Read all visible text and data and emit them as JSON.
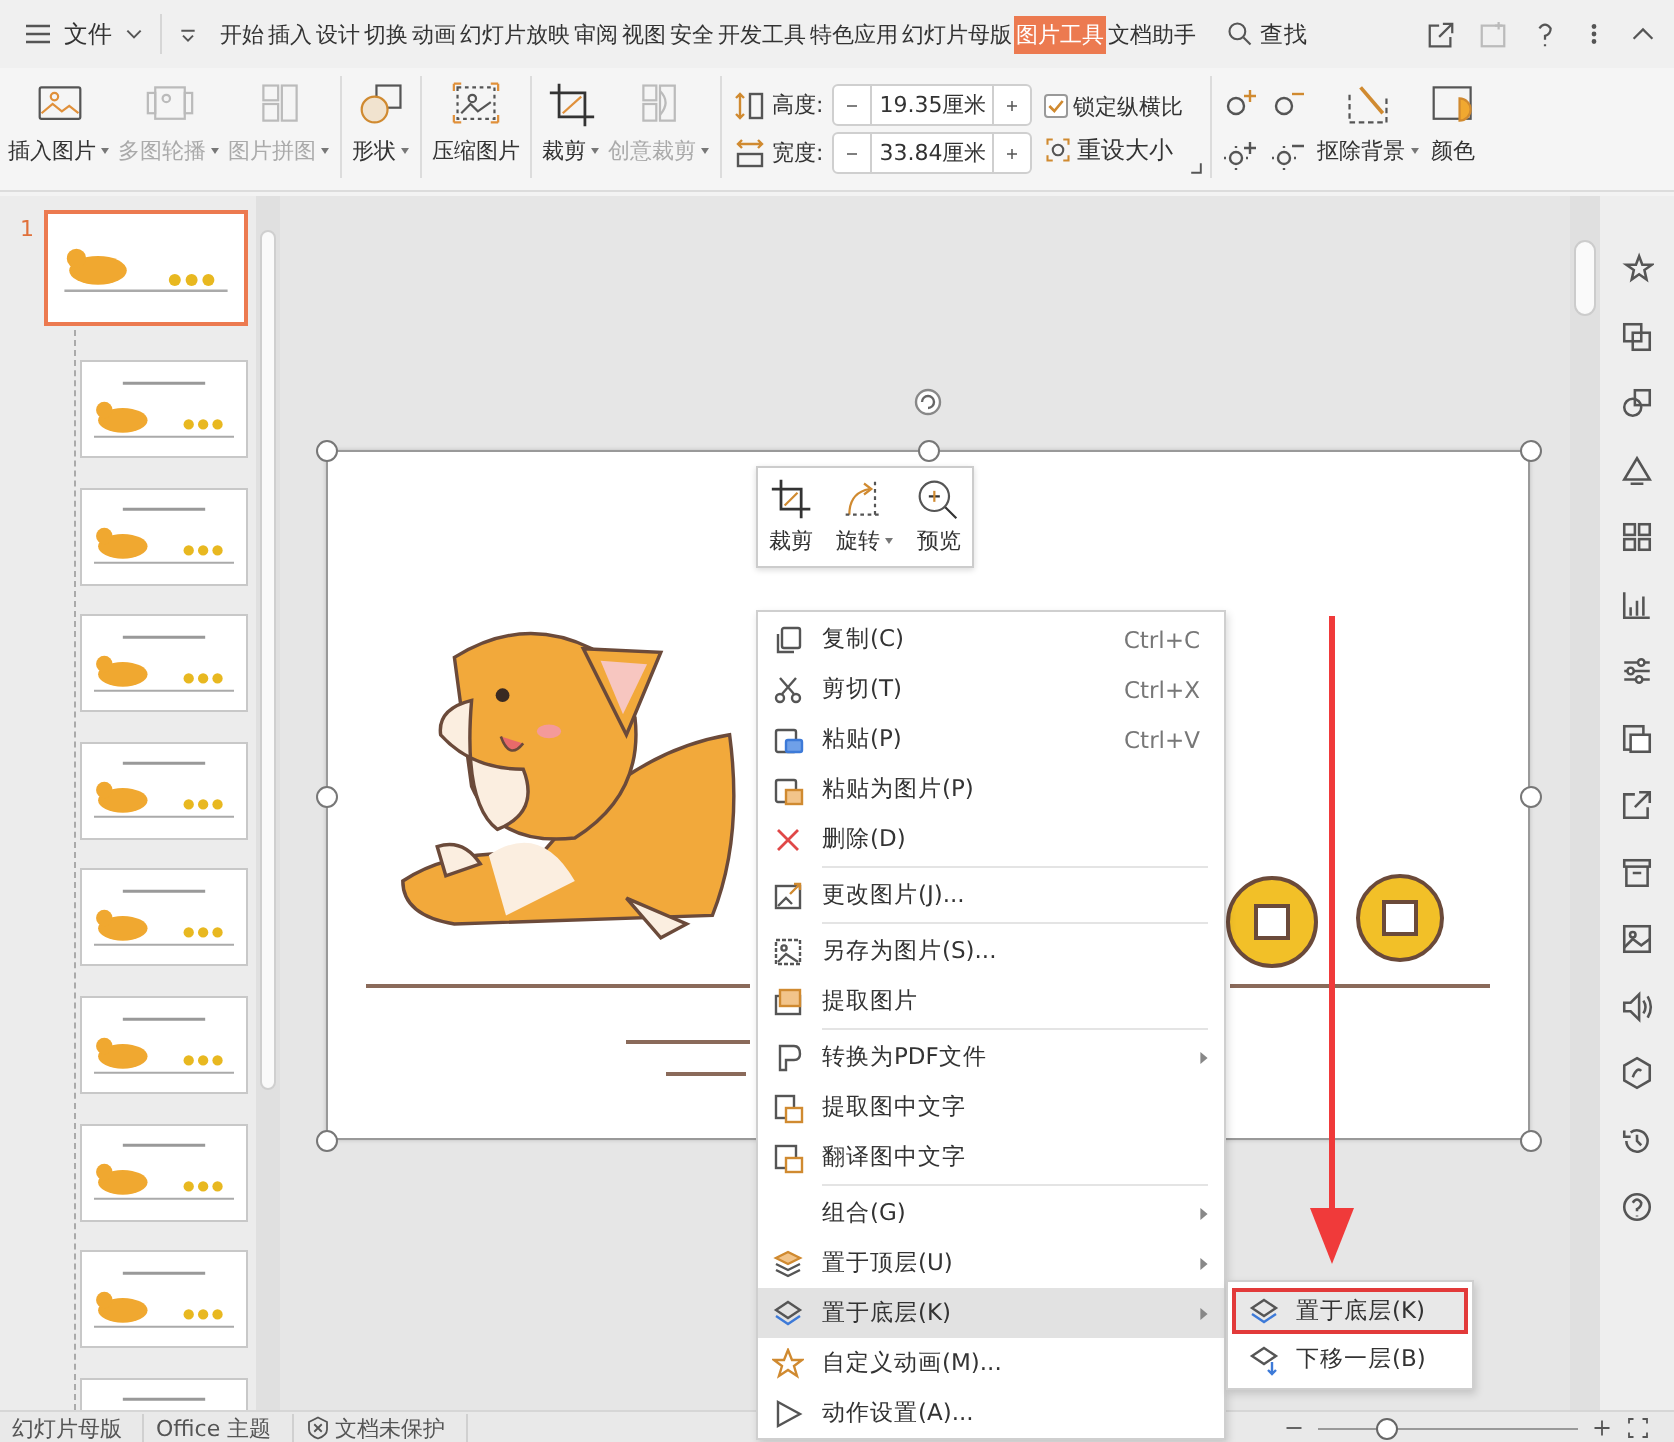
{
  "menu_bar": {
    "file_label": "文件",
    "search_label": "查找",
    "tabs": [
      {
        "label": "开始",
        "selected": false
      },
      {
        "label": "插入",
        "selected": false
      },
      {
        "label": "设计",
        "selected": false
      },
      {
        "label": "切换",
        "selected": false
      },
      {
        "label": "动画",
        "selected": false
      },
      {
        "label": "幻灯片放映",
        "selected": false
      },
      {
        "label": "审阅",
        "selected": false
      },
      {
        "label": "视图",
        "selected": false
      },
      {
        "label": "安全",
        "selected": false
      },
      {
        "label": "开发工具",
        "selected": false
      },
      {
        "label": "特色应用",
        "selected": false
      },
      {
        "label": "幻灯片母版",
        "selected": false
      },
      {
        "label": "图片工具",
        "selected": true
      },
      {
        "label": "文档助手",
        "selected": false
      }
    ]
  },
  "ribbon": {
    "groups": [
      [
        {
          "label": "插入图片",
          "dropdown": true,
          "disabled": false
        },
        {
          "label": "多图轮播",
          "dropdown": true,
          "disabled": true
        },
        {
          "label": "图片拼图",
          "dropdown": true,
          "disabled": true
        }
      ],
      [
        {
          "label": "形状",
          "dropdown": true,
          "disabled": false
        }
      ],
      [
        {
          "label": "压缩图片",
          "dropdown": false,
          "disabled": false
        }
      ],
      [
        {
          "label": "裁剪",
          "dropdown": true,
          "disabled": false
        },
        {
          "label": "创意裁剪",
          "dropdown": true,
          "disabled": true
        }
      ]
    ],
    "height": {
      "label": "高度:",
      "value": "19.35厘米"
    },
    "width": {
      "label": "宽度:",
      "value": "33.84厘米"
    },
    "lock_aspect": {
      "label": "锁定纵横比",
      "checked": true
    },
    "reset_size": {
      "label": "重设大小"
    },
    "remove_background": {
      "label": "抠除背景",
      "dropdown": true
    },
    "color": {
      "label": "颜色"
    }
  },
  "thumbnails": [
    {
      "number": "1",
      "selected": true,
      "children": [
        {
          "selected": false
        },
        {
          "selected": false
        },
        {
          "selected": false
        },
        {
          "selected": false
        },
        {
          "selected": false
        },
        {
          "selected": false
        },
        {
          "selected": false
        },
        {
          "selected": false
        },
        {
          "selected": false
        }
      ]
    }
  ],
  "mini_toolbar": [
    {
      "label": "裁剪",
      "dropdown": false
    },
    {
      "label": "旋转",
      "dropdown": true
    },
    {
      "label": "预览",
      "dropdown": false
    }
  ],
  "context_menu": [
    {
      "kind": "item",
      "label": "复制(C)",
      "shortcut": "Ctrl+C",
      "submenu": false,
      "highlighted": false
    },
    {
      "kind": "item",
      "label": "剪切(T)",
      "shortcut": "Ctrl+X",
      "submenu": false,
      "highlighted": false
    },
    {
      "kind": "item",
      "label": "粘贴(P)",
      "shortcut": "Ctrl+V",
      "submenu": false,
      "highlighted": false
    },
    {
      "kind": "item",
      "label": "粘贴为图片(P)",
      "submenu": false,
      "highlighted": false
    },
    {
      "kind": "item",
      "label": "删除(D)",
      "submenu": false,
      "highlighted": false
    },
    {
      "kind": "separator"
    },
    {
      "kind": "item",
      "label": "更改图片(J)...",
      "submenu": false,
      "highlighted": false
    },
    {
      "kind": "separator"
    },
    {
      "kind": "item",
      "label": "另存为图片(S)...",
      "submenu": false,
      "highlighted": false
    },
    {
      "kind": "item",
      "label": "提取图片",
      "submenu": false,
      "highlighted": false
    },
    {
      "kind": "separator"
    },
    {
      "kind": "item",
      "label": "转换为PDF文件",
      "submenu": true,
      "highlighted": false
    },
    {
      "kind": "item",
      "label": "提取图中文字",
      "submenu": false,
      "highlighted": false
    },
    {
      "kind": "item",
      "label": "翻译图中文字",
      "submenu": false,
      "highlighted": false
    },
    {
      "kind": "separator"
    },
    {
      "kind": "item",
      "label": "组合(G)",
      "submenu": true,
      "highlighted": false
    },
    {
      "kind": "item",
      "label": "置于顶层(U)",
      "submenu": true,
      "highlighted": false
    },
    {
      "kind": "item",
      "label": "置于底层(K)",
      "submenu": true,
      "highlighted": true
    },
    {
      "kind": "item",
      "label": "自定义动画(M)...",
      "submenu": false,
      "highlighted": false
    },
    {
      "kind": "item",
      "label": "动作设置(A)...",
      "submenu": false,
      "highlighted": false
    }
  ],
  "submenu": [
    {
      "label": "置于底层(K)",
      "selected": true
    },
    {
      "label": "下移一层(B)",
      "selected": false
    }
  ],
  "status_bar": {
    "items": [
      {
        "kind": "text",
        "label": "幻灯片母版"
      },
      {
        "kind": "text",
        "label": "Office 主题"
      },
      {
        "kind": "protection",
        "label": "文档未保护"
      }
    ],
    "zoom": {
      "level": 0.26
    }
  }
}
